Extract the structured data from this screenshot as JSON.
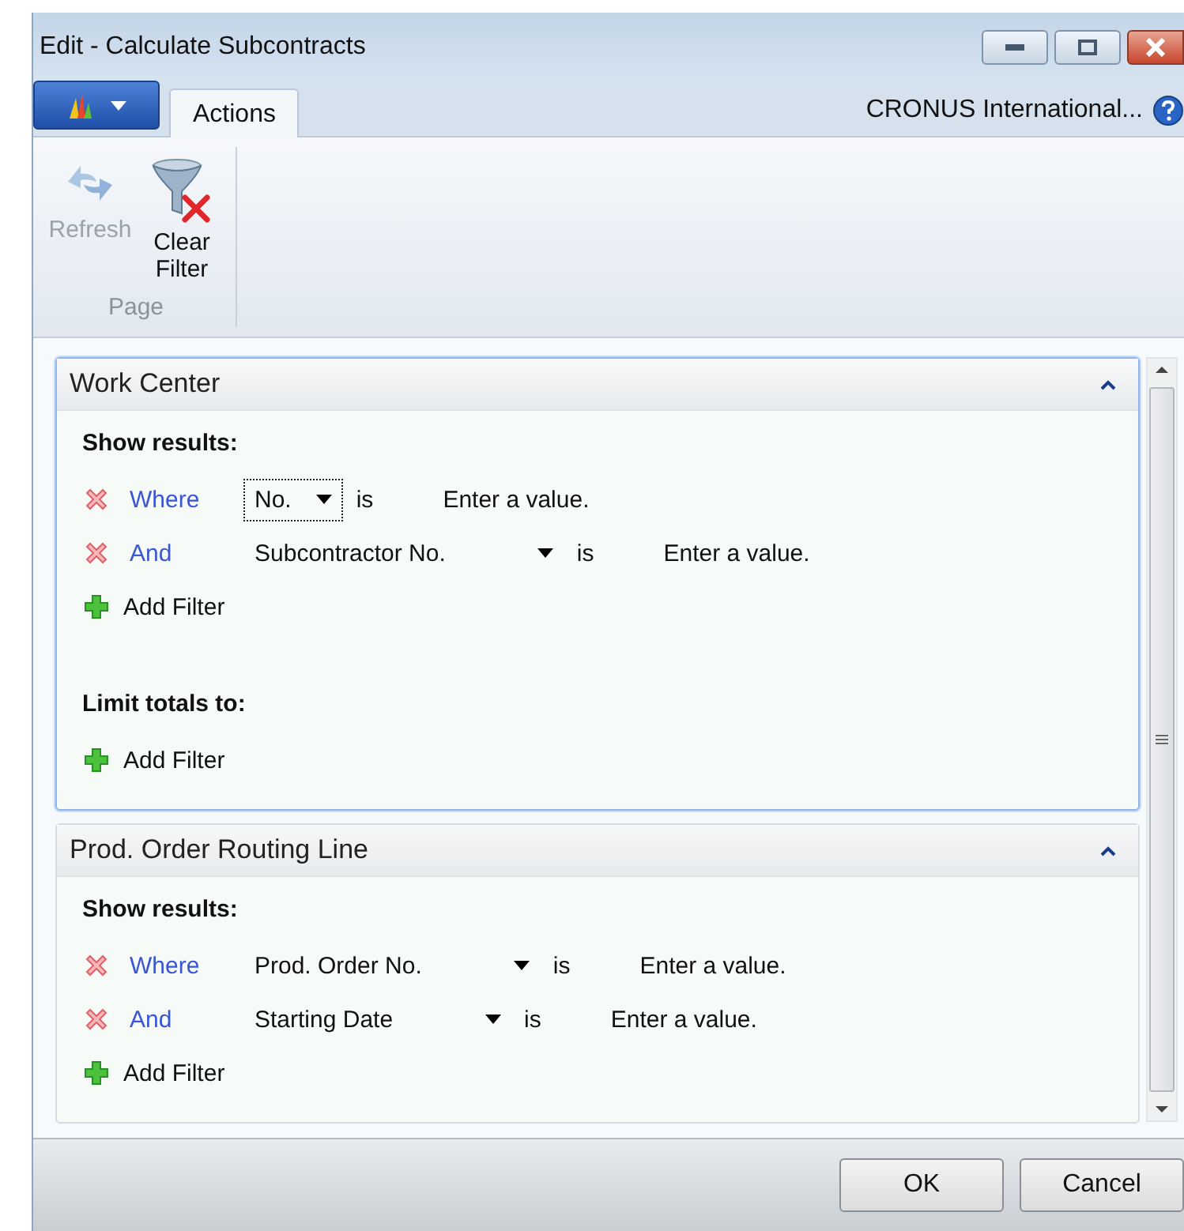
{
  "window": {
    "title": "Edit - Calculate Subcontracts"
  },
  "ribbon": {
    "tabs": [
      {
        "label": "Actions",
        "selected": true
      }
    ],
    "company": "CRONUS International...",
    "groups": [
      {
        "label": "Page",
        "buttons": [
          {
            "label": "Refresh",
            "kind": "refresh",
            "disabled": true
          },
          {
            "label": "Clear Filter",
            "kind": "clear-filter",
            "disabled": false
          }
        ]
      }
    ]
  },
  "sections": [
    {
      "title": "Work Center",
      "expanded": true,
      "focused": true,
      "groups": [
        {
          "heading": "Show results:",
          "add_label": "Add Filter",
          "filters": [
            {
              "connector": "Where",
              "field": "No.",
              "focused": true,
              "operator": "is",
              "placeholder": "Enter a value."
            },
            {
              "connector": "And",
              "field": "Subcontractor No.",
              "focused": false,
              "operator": "is",
              "placeholder": "Enter a value."
            }
          ]
        },
        {
          "heading": "Limit totals to:",
          "add_label": "Add Filter"
        }
      ]
    },
    {
      "title": "Prod. Order Routing Line",
      "expanded": true,
      "focused": false,
      "groups": [
        {
          "heading": "Show results:",
          "add_label": "Add Filter",
          "filters": [
            {
              "connector": "Where",
              "field": "Prod. Order No.",
              "focused": false,
              "operator": "is",
              "placeholder": "Enter a value."
            },
            {
              "connector": "And",
              "field": "Starting Date",
              "focused": false,
              "operator": "is",
              "placeholder": "Enter a value."
            }
          ]
        }
      ]
    }
  ],
  "buttons": [
    {
      "label": "OK"
    },
    {
      "label": "Cancel"
    }
  ]
}
